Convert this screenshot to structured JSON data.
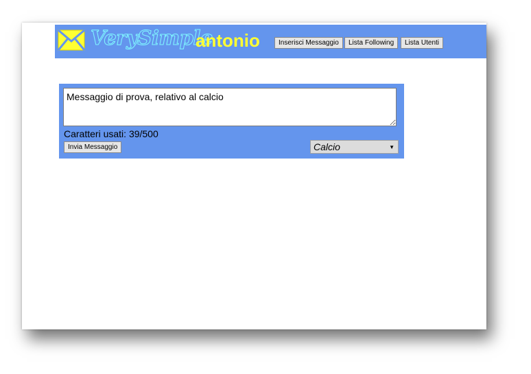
{
  "header": {
    "logo_text": "VerySimple",
    "username": "antonio",
    "nav": {
      "insert_message": "Inserisci Messaggio",
      "following_list": "Lista Following",
      "users_list": "Lista Utenti"
    }
  },
  "composer": {
    "message": "Messaggio di prova, relativo al calcio",
    "chars_label": "Caratteri usati:",
    "chars_used": "39/500",
    "send_label": "Invia Messaggio",
    "category_selected": "Calcio"
  },
  "icons": {
    "logo": "envelope-icon",
    "select_arrow": "triangle-down-icon"
  },
  "colors": {
    "header_bg": "#6495ed",
    "username": "#ffff33",
    "logo_outline": "#7ff5ff",
    "envelope": "#ffff33"
  }
}
